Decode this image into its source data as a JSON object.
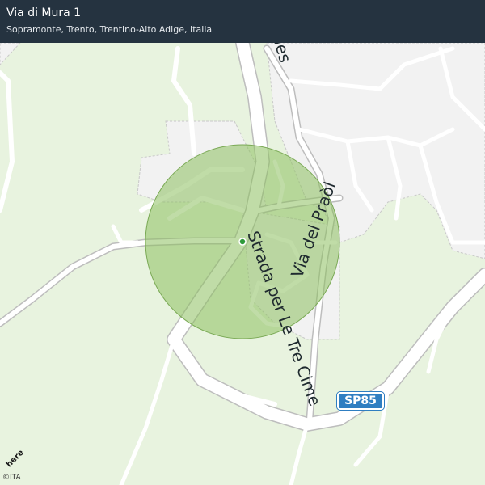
{
  "header": {
    "title": "Via di Mura 1",
    "subtitle": "Sopramonte, Trento, Trentino-Alto Adige, Italia"
  },
  "roads": {
    "strada_label": "Strada per Le Tre Cime",
    "praol_label": "Via del Praòl",
    "sales_label": "del Sales"
  },
  "shield": {
    "label": "SP85"
  },
  "attribution": {
    "logo": "here",
    "copyright": "©ITA"
  },
  "colors": {
    "land": "#e8f3df",
    "urban": "#f2f2f2",
    "road": "#ffffff",
    "road_casing": "#bdbdbd",
    "accuracy_circle": "#8cbf5f",
    "marker": "#2e9a3a",
    "header_bg": "#253340",
    "shield_bg": "#2f7ec1"
  }
}
